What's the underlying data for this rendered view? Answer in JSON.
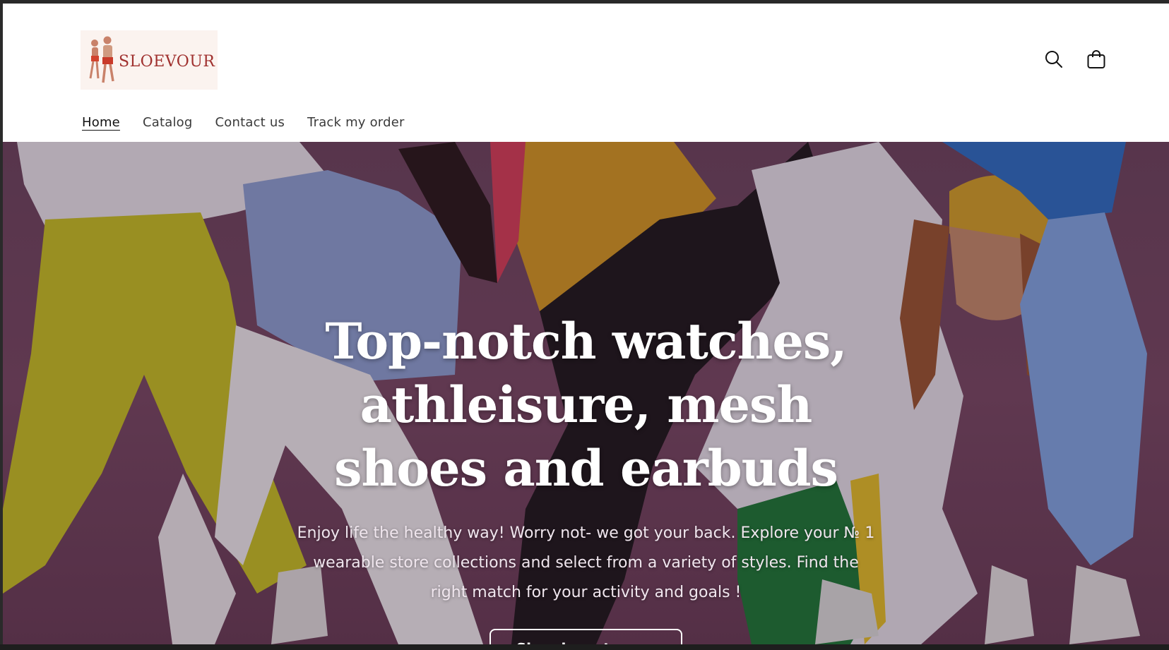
{
  "brand": {
    "name": "SLOEVOUR",
    "logo_color": "#a0312f"
  },
  "header": {
    "icons": {
      "search": "search-icon",
      "cart": "cart-icon"
    }
  },
  "nav": {
    "items": [
      {
        "label": "Home",
        "active": true
      },
      {
        "label": "Catalog"
      },
      {
        "label": "Contact us"
      },
      {
        "label": "Track my order"
      }
    ]
  },
  "hero": {
    "title": "Top-notch watches, athleisure, mesh shoes and earbuds",
    "subtitle": "Enjoy life the healthy way! Worry not- we got your back. Explore your № 1 wearable store collections and select from a variety of styles. Find the right match for your activity and goals !",
    "button_label": "Shop by category"
  },
  "colors": {
    "hero_background": "#7a4a66",
    "text": "#121212"
  }
}
